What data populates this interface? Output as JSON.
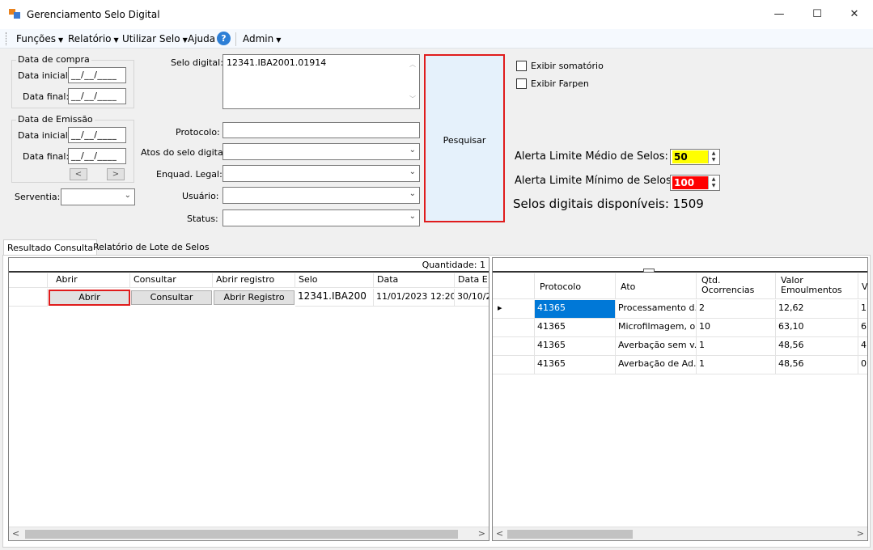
{
  "window": {
    "title": "Gerenciamento Selo Digital",
    "minimize": "—",
    "maximize": "☐",
    "close": "✕"
  },
  "menu": {
    "funcoes": "Funções",
    "relatorio": "Relatório",
    "utilizar_selo": "Utilizar Selo",
    "ajuda": "Ajuda",
    "help_glyph": "?",
    "admin": "Admin"
  },
  "filters": {
    "data_compra": {
      "legend": "Data de compra",
      "inicial_label": "Data inicial:",
      "final_label": "Data final:",
      "inicial_value": "__/__/____",
      "final_value": "__/__/____"
    },
    "data_emissao": {
      "legend": "Data de Emissão",
      "inicial_label": "Data inicial:",
      "final_label": "Data final:",
      "inicial_value": "__/__/____",
      "final_value": "__/__/____",
      "prev": "<",
      "next": ">"
    },
    "serventia_label": "Serventia:",
    "selo_digital_label": "Selo digital:",
    "selo_digital_value": "12341.IBA2001.01914",
    "protocolo_label": "Protocolo:",
    "atos_label": "Atos do selo digital:",
    "enquad_label": "Enquad. Legal:",
    "usuario_label": "Usuário:",
    "status_label": "Status:"
  },
  "search_button": "Pesquisar",
  "options": {
    "exibir_somatorio": "Exibir somatório",
    "exibir_farpen": "Exibir Farpen"
  },
  "alerts": {
    "medio_label": "Alerta Limite Médio de Selos:",
    "medio_value": "50",
    "medio_color": "#ffff00",
    "minimo_label": "Alerta Limite Mínimo de Selos:",
    "minimo_value": "100",
    "minimo_color": "#ff0000",
    "disponiveis_text": "Selos digitais disponíveis: 1509"
  },
  "tabs": [
    "Resultado Consulta",
    "Relatório de Lote de Selos"
  ],
  "left_grid": {
    "quantidade": "Quantidade: 1",
    "headers": [
      "Abrir",
      "Consultar",
      "Abrir registro",
      "Selo",
      "Data",
      "Data E"
    ],
    "row": {
      "abrir": "Abrir",
      "consultar": "Consultar",
      "abrir_registro": "Abrir Registro",
      "selo": "12341.IBA200",
      "data": "11/01/2023 12:20",
      "data_e": "30/10/2"
    }
  },
  "right_grid": {
    "headers": [
      "Protocolo",
      "Ato",
      "Qtd.\nOcorrencias",
      "Valor\nEmoulmentos",
      "V"
    ],
    "rows": [
      {
        "protocolo": "41365",
        "ato": "Processamento d...",
        "qtd": "2",
        "valor": "12,62",
        "v": "1,"
      },
      {
        "protocolo": "41365",
        "ato": "Microfilmagem, o...",
        "qtd": "10",
        "valor": "63,10",
        "v": "6,"
      },
      {
        "protocolo": "41365",
        "ato": "Averbação sem v...",
        "qtd": "1",
        "valor": "48,56",
        "v": "4,"
      },
      {
        "protocolo": "41365",
        "ato": "Averbação de Ad...",
        "qtd": "1",
        "valor": "48,56",
        "v": "0,"
      }
    ]
  },
  "colors": {
    "selected_cell": "#0078d7",
    "highlight_border": "#e01c1c"
  }
}
